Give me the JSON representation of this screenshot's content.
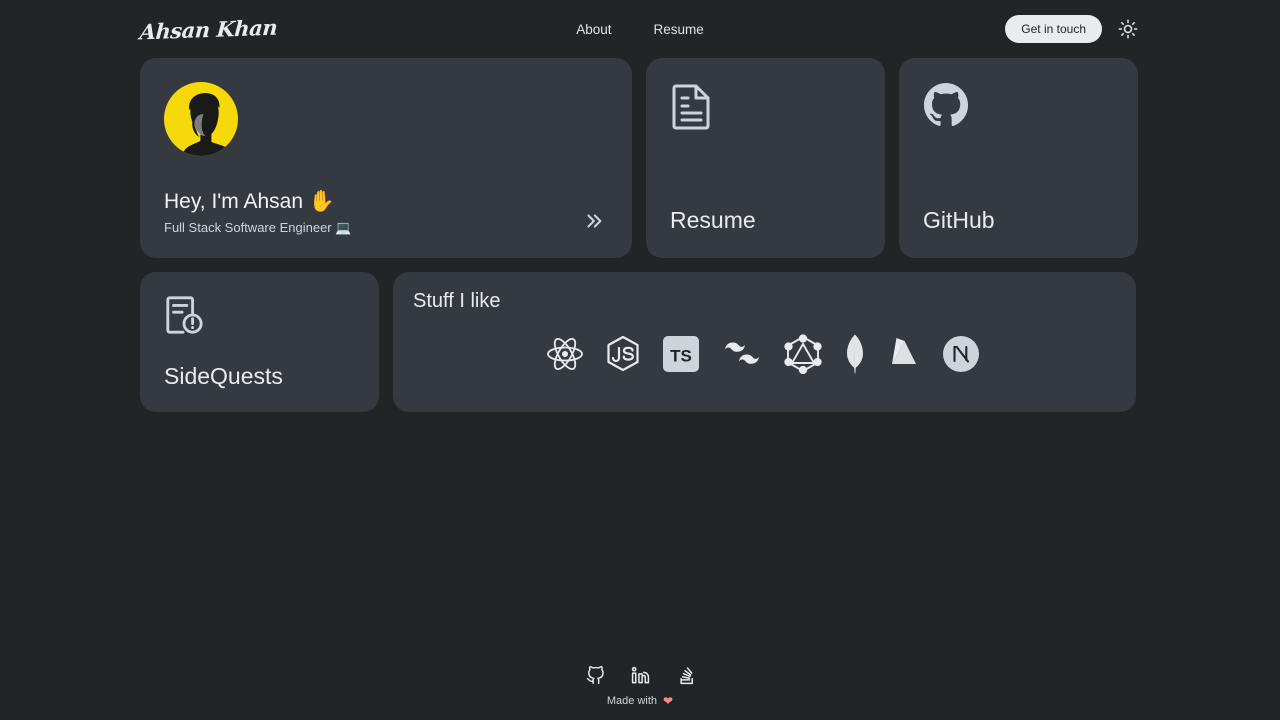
{
  "theme": {
    "page_bg": "#222528",
    "card_bg": "#343a40",
    "accent_yellow": "#f5d90a",
    "text_primary": "#e9ecef",
    "text_secondary": "#ced4da",
    "heart_color": "#ff8787",
    "pill_bg": "#e9ecef"
  },
  "header": {
    "logo_text": "Ahsan Khan",
    "nav": [
      {
        "label": "About"
      },
      {
        "label": "Resume"
      }
    ],
    "cta_label": "Get in touch",
    "theme_toggle_icon": "sun-icon"
  },
  "cards": {
    "hero": {
      "avatar_icon": "profile-avatar",
      "heading": "Hey, I'm Ahsan",
      "heading_emoji": "✋",
      "subtitle": "Full Stack Software Engineer",
      "subtitle_emoji": "💻",
      "expand_icon": "double-chevron-right-icon"
    },
    "resume": {
      "icon": "document-icon",
      "title": "Resume"
    },
    "github": {
      "icon": "github-icon",
      "title": "GitHub"
    },
    "sidequests": {
      "icon": "document-alert-icon",
      "title": "SideQuests"
    },
    "stuff": {
      "title": "Stuff I like",
      "items": [
        {
          "name": "react-icon",
          "label": "React"
        },
        {
          "name": "nodejs-icon",
          "label": "Node.js"
        },
        {
          "name": "typescript-icon",
          "label": "TS"
        },
        {
          "name": "tailwindcss-icon",
          "label": "Tailwind CSS"
        },
        {
          "name": "graphql-icon",
          "label": "GraphQL"
        },
        {
          "name": "mongodb-icon",
          "label": "MongoDB"
        },
        {
          "name": "firebase-icon",
          "label": "Firebase"
        },
        {
          "name": "nextjs-icon",
          "label": "Next.js"
        }
      ]
    }
  },
  "footer": {
    "social": [
      {
        "name": "github-icon",
        "label": "GitHub"
      },
      {
        "name": "linkedin-icon",
        "label": "LinkedIn"
      },
      {
        "name": "stackoverflow-icon",
        "label": "Stack Overflow"
      }
    ],
    "made_with_text": "Made with",
    "made_with_emoji": "❤"
  }
}
